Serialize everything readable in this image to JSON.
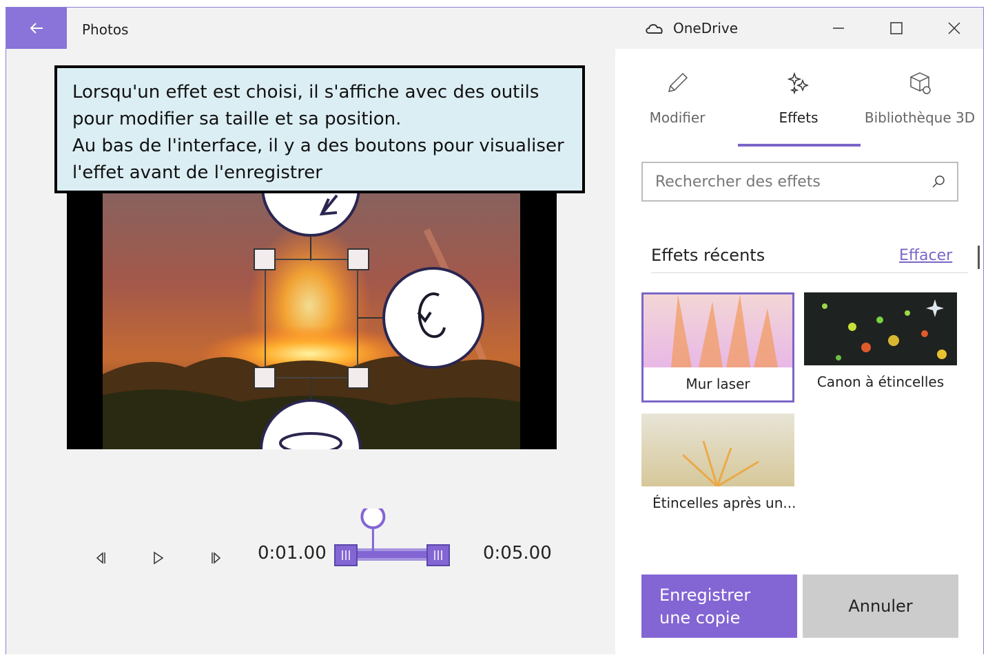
{
  "titlebar": {
    "app_title": "Photos",
    "onedrive_label": "OneDrive"
  },
  "callout": {
    "lines": [
      "Lorsqu'un effet est choisi, il s'affiche avec des outils",
      "pour modifier sa taille et sa position.",
      "Au bas de l'interface, il y a des boutons pour visualiser",
      "l'effet avant de l'enregistrer"
    ]
  },
  "player": {
    "current_time": "0:01.00",
    "end_time": "0:05.00",
    "playhead_fraction": 0.2
  },
  "panel": {
    "tabs": [
      {
        "label": "Modifier",
        "icon": "pencil-icon"
      },
      {
        "label": "Effets",
        "icon": "sparkle-icon"
      },
      {
        "label": "Bibliothèque 3D",
        "icon": "cube-icon"
      }
    ],
    "search_placeholder": "Rechercher des effets",
    "recent_title": "Effets récents",
    "clear_label": "Effacer",
    "effects": [
      {
        "label": "Mur laser",
        "selected": true
      },
      {
        "label": "Canon à étincelles",
        "selected": false
      },
      {
        "label": "Étincelles après un...",
        "selected": false
      }
    ],
    "save_label": "Enregistrer une copie",
    "cancel_label": "Annuler"
  },
  "colors": {
    "accent": "#8365d4",
    "back_button": "#8a73d9",
    "callout_bg": "#dbeef4"
  }
}
